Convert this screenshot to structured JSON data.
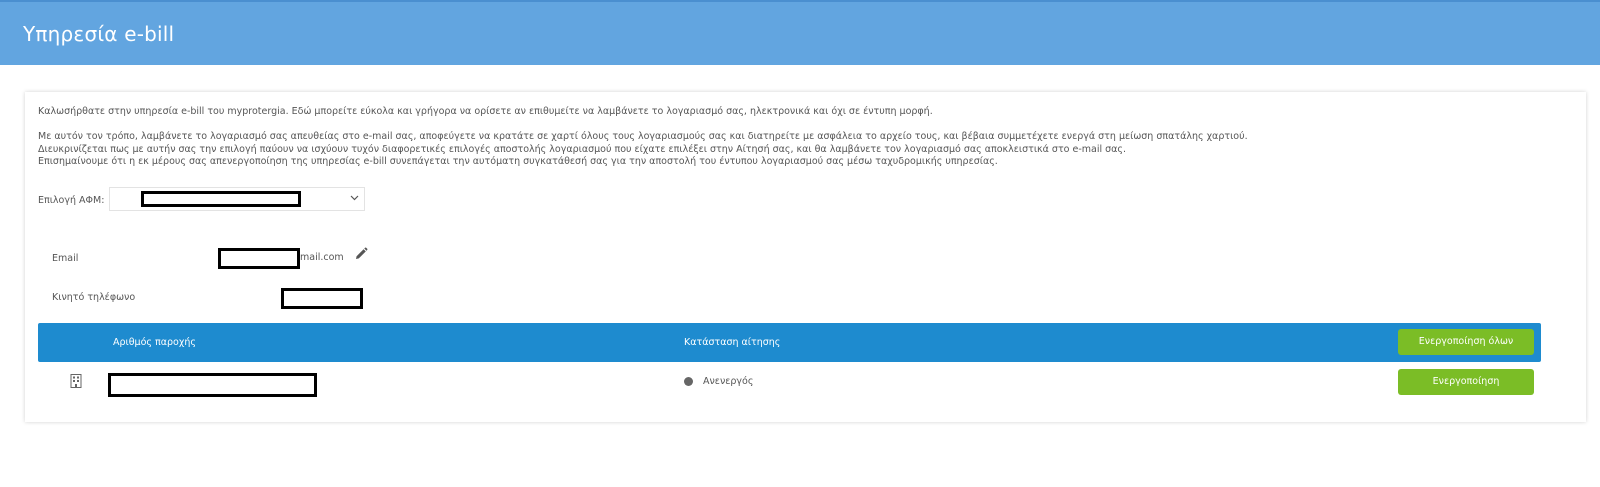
{
  "header": {
    "title": "Υπηρεσία e-bill"
  },
  "intro": {
    "p1": "Καλωσήρθατε στην υπηρεσία e-bill του myprotergia. Εδώ μπορείτε εύκολα και γρήγορα να ορίσετε αν επιθυμείτε να λαμβάνετε το λογαριασμό σας, ηλεκτρονικά και όχι σε έντυπη μορφή.",
    "p2": "Με αυτόν τον τρόπο, λαμβάνετε το λογαριασμό σας απευθείας στο e-mail σας, αποφεύγετε να κρατάτε σε χαρτί όλους τους λογαριασμούς σας και διατηρείτε με ασφάλεια το αρχείο τους, και βέβαια συμμετέχετε ενεργά στη μείωση σπατάλης χαρτιού.",
    "p3": "Διευκρινίζεται πως με αυτήν σας την επιλογή παύουν να ισχύουν τυχόν διαφορετικές επιλογές αποστολής λογαριασμού που είχατε επιλέξει στην Αίτησή σας, και θα λαμβάνετε τον λογαριασμό σας αποκλειστικά στο e-mail σας.",
    "p4": "Επισημαίνουμε ότι η εκ μέρους σας απενεργοποίηση της υπηρεσίας e-bill συνεπάγεται την αυτόματη συγκατάθεσή σας για την αποστολή του έντυπου λογαριασμού σας μέσω ταχυδρομικής υπηρεσίας."
  },
  "afm": {
    "label": "Επιλογή ΑΦΜ:",
    "chevron_icon": "chevron-down-icon"
  },
  "contact": {
    "email_label": "Email",
    "email_suffix": "mail.com",
    "edit_icon": "pencil-icon",
    "mobile_label": "Κινητό τηλέφωνο"
  },
  "table": {
    "header_bg": "#1e8bcf",
    "col_supply": "Αριθμός παροχής",
    "col_status": "Κατάσταση αίτησης",
    "activate_all_label": "Ενεργοποίηση όλων",
    "rows": [
      {
        "icon": "building-icon",
        "status": "Ανενεργός",
        "status_color": "#666666",
        "action_label": "Ενεργοποίηση"
      }
    ]
  },
  "colors": {
    "header_bg": "#62a5e0",
    "button_bg": "#7bbd26"
  }
}
